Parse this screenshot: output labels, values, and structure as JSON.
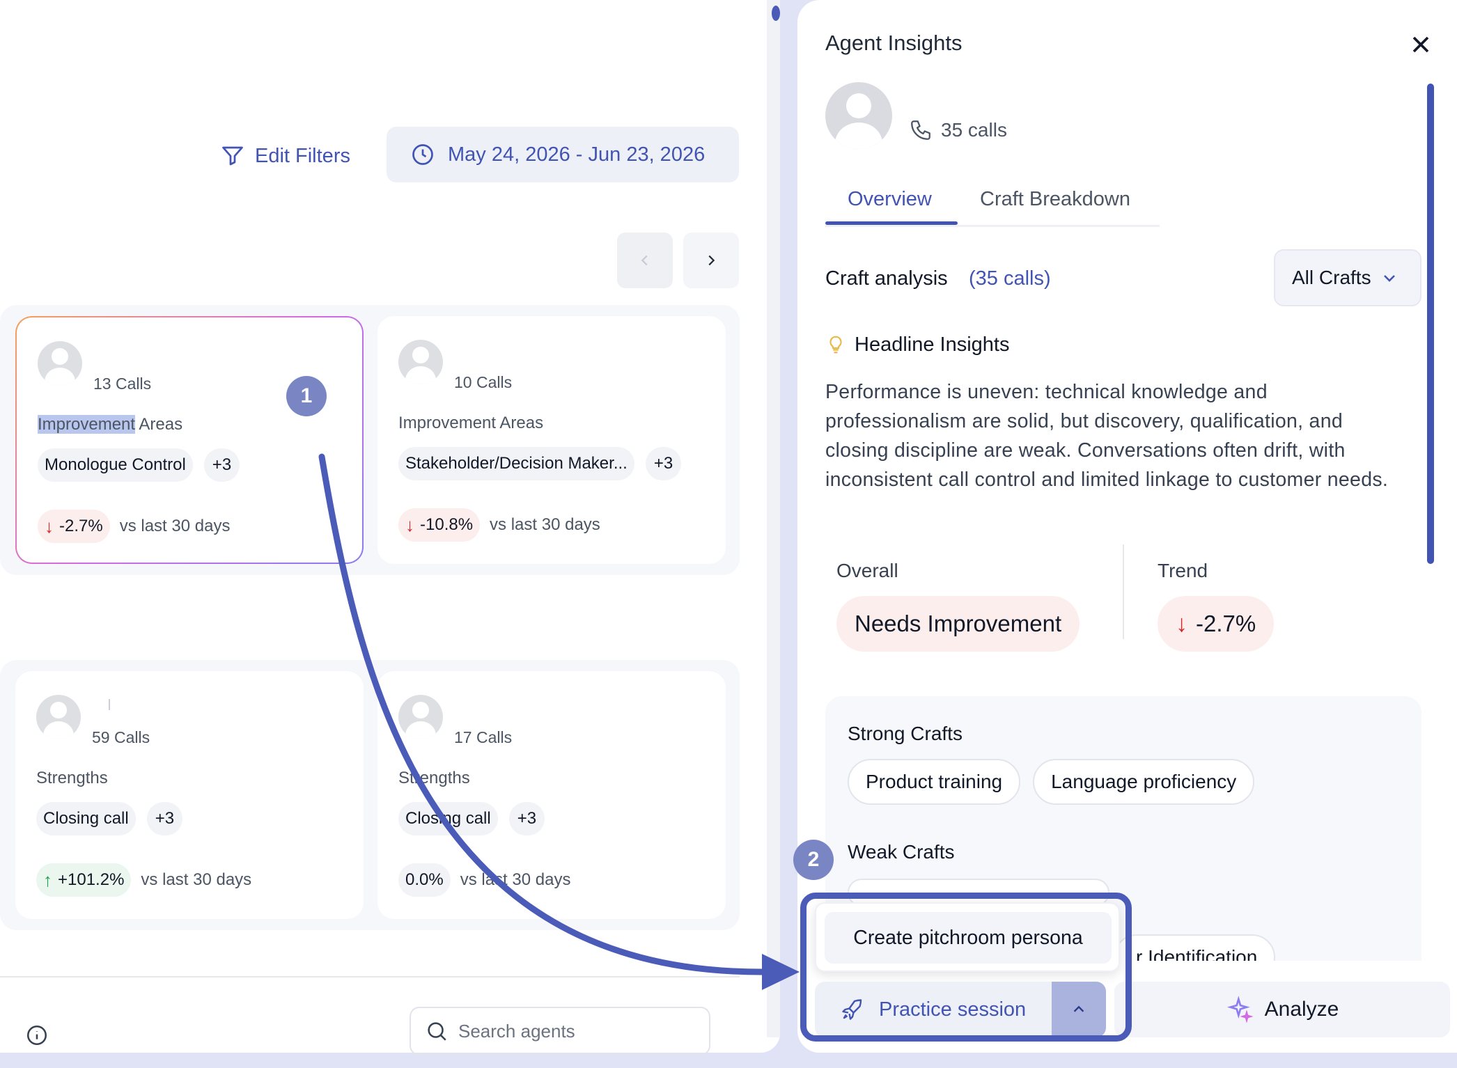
{
  "filters": {
    "edit_label": "Edit Filters",
    "date_range": "May 24, 2026 - Jun 23, 2026"
  },
  "pager": {
    "prev": "‹",
    "next": "›"
  },
  "cards": [
    {
      "calls": "13 Calls",
      "section_highlight": "Improvement",
      "section_rest": " Areas",
      "chip": "Monologue Control",
      "more": "+3",
      "trend": "-2.7%",
      "trend_dir": "down",
      "vs": "vs last 30 days"
    },
    {
      "calls": "10 Calls",
      "section": "Improvement Areas",
      "chip": "Stakeholder/Decision Maker...",
      "more": "+3",
      "trend": "-10.8%",
      "trend_dir": "down",
      "vs": "vs last 30 days"
    },
    {
      "calls": "59 Calls",
      "section": "Strengths",
      "chip": "Closing call",
      "more": "+3",
      "trend": "+101.2%",
      "trend_dir": "up",
      "vs": "vs last 30 days"
    },
    {
      "calls": "17 Calls",
      "section": "Strengths",
      "chip": "Closing call",
      "more": "+3",
      "trend": "0.0%",
      "trend_dir": "flat",
      "vs": "vs last 30 days"
    }
  ],
  "search": {
    "placeholder": "Search agents"
  },
  "annotations": {
    "badge_1": "1",
    "badge_2": "2"
  },
  "panel": {
    "title": "Agent Insights",
    "calls": "35 calls",
    "tabs": [
      "Overview",
      "Craft Breakdown"
    ],
    "craft_analysis": "Craft analysis",
    "craft_calls": "(35 calls)",
    "crafts_select": "All Crafts",
    "headline_title": "Headline Insights",
    "headline_text": "Performance is uneven: technical knowledge and professionalism are solid, but discovery, qualification, and closing discipline are weak. Conversations often drift, with inconsistent call control and limited linkage to customer needs.",
    "overall_label": "Overall",
    "overall_value": "Needs Improvement",
    "trend_label": "Trend",
    "trend_value": "-2.7%",
    "strong_title": "Strong Crafts",
    "strong_crafts": [
      "Product training",
      "Language proficiency"
    ],
    "weak_title": "Weak Crafts",
    "weak_craft_visible": "r Identification",
    "create_persona": "Create pitchroom persona",
    "practice_session": "Practice session",
    "analyze": "Analyze"
  },
  "colors": {
    "accent": "#4254b3",
    "annotation": "#4a5bb8",
    "down": "#dc2626",
    "up": "#16a34a"
  }
}
